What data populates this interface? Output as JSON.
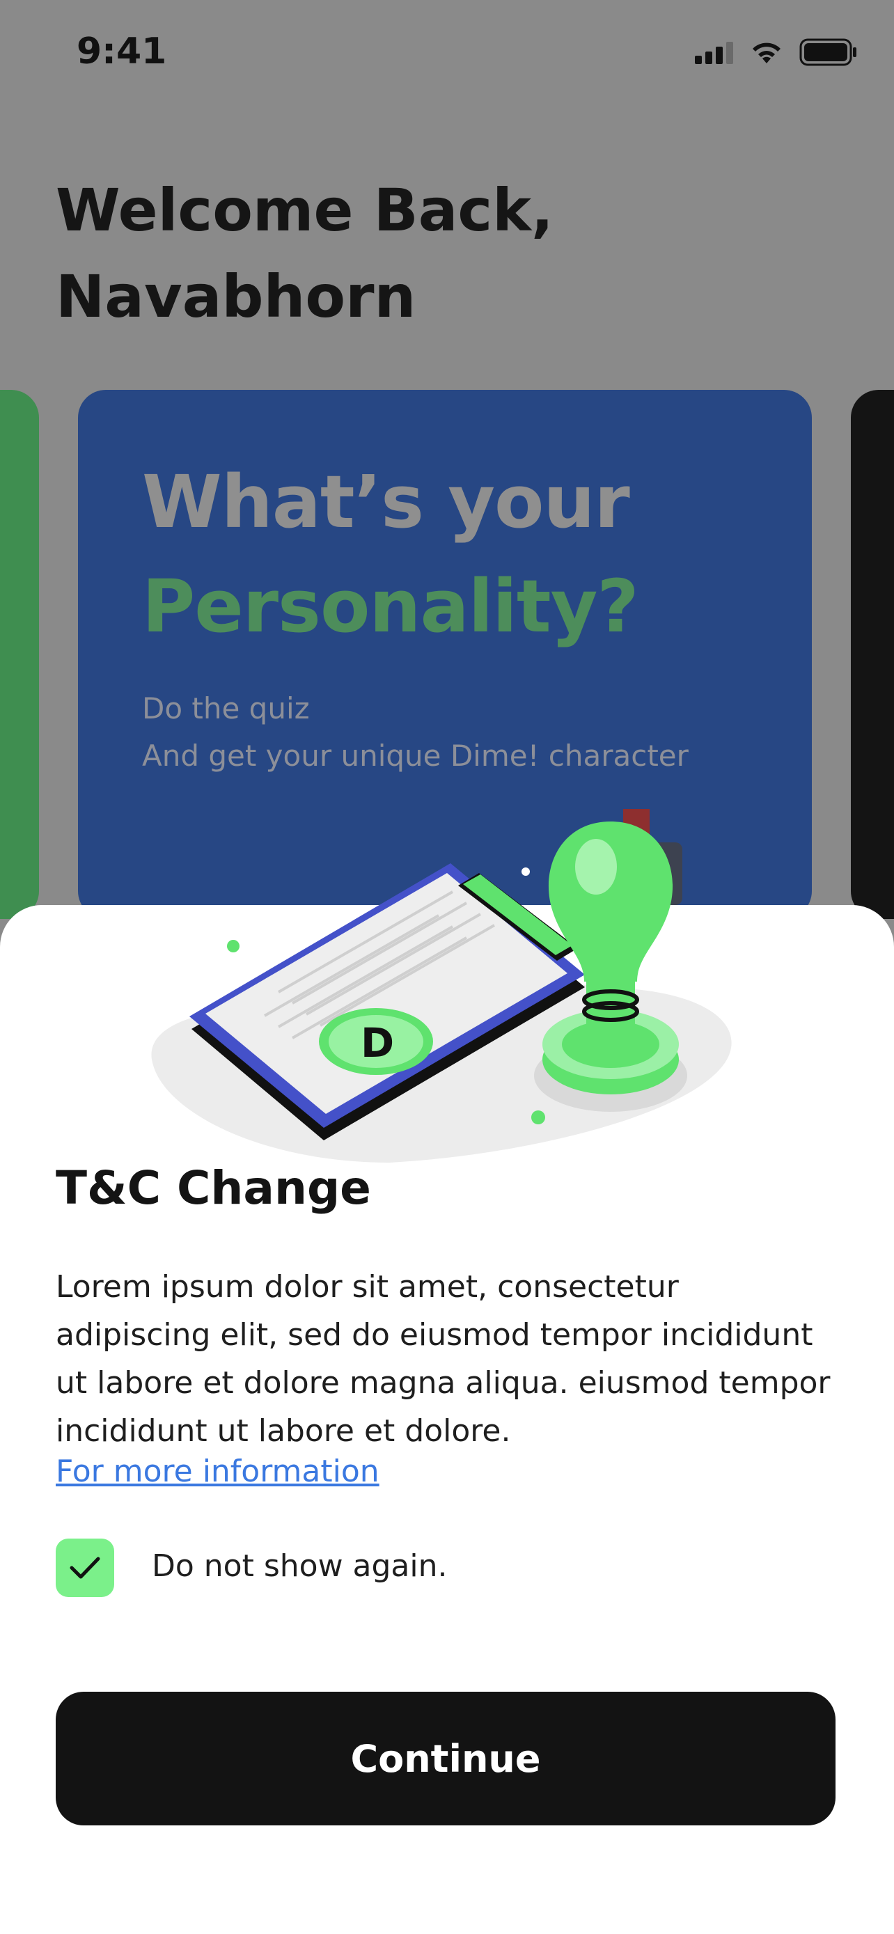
{
  "status_bar": {
    "time": "9:41"
  },
  "home": {
    "welcome_line1": "Welcome Back,",
    "welcome_line2": "Navabhorn",
    "card": {
      "title_line1": "What’s your",
      "title_line2": "Personality?",
      "subtitle_line1": "Do the quiz",
      "subtitle_line2": "And get your unique Dime! character"
    }
  },
  "sheet": {
    "title": "T&C Change",
    "body": "Lorem ipsum dolor sit amet, consectetur adipiscing elit, sed do eiusmod tempor incididunt ut labore et dolore magna aliqua. eiusmod tempor incididunt ut labore et dolore.",
    "link": "For more information",
    "checkbox_label": "Do not show again.",
    "checkbox_checked": true,
    "continue_label": "Continue"
  },
  "colors": {
    "accent_green": "#7bf08a",
    "link_blue": "#3a78e0",
    "button_black": "#131313",
    "card_blue": "#274784"
  },
  "icons": [
    "signal-icon",
    "wifi-icon",
    "battery-icon",
    "checkmark-icon",
    "clipboard-stamp-illustration"
  ]
}
